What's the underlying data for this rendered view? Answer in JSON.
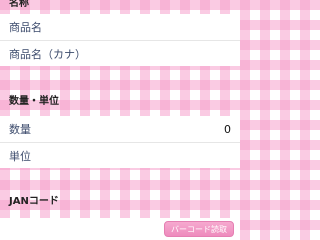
{
  "sections": {
    "name": {
      "header": "名称",
      "rows": {
        "product_name": {
          "label": "商品名",
          "value": ""
        },
        "product_name_kana": {
          "label": "商品名（カナ）",
          "value": ""
        }
      }
    },
    "quantity": {
      "header": "数量・単位",
      "rows": {
        "quantity": {
          "label": "数量",
          "value": "0"
        },
        "unit": {
          "label": "単位",
          "value": ""
        }
      }
    },
    "jan": {
      "header": "JANコード"
    }
  },
  "scan_button": {
    "label": "バーコード読取"
  }
}
